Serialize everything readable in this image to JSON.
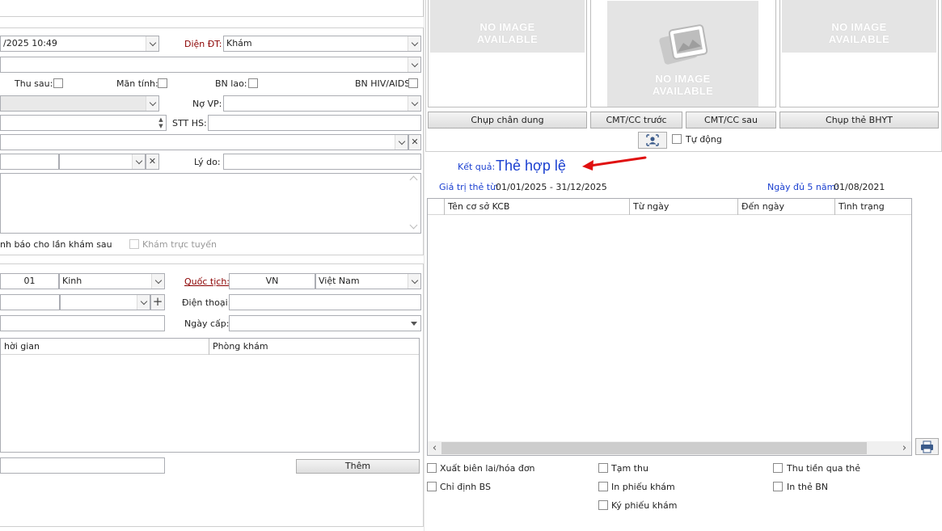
{
  "left": {
    "reg_time": "/2025 10:49",
    "dien_dt_label": "Diện ĐT:",
    "dien_dt_value": "Khám",
    "thu_sau_label": "Thu sau:",
    "man_tinh_label": "Mãn tính:",
    "bn_lao_label": "BN lao:",
    "bn_hiv_label": "BN HIV/AIDS",
    "no_vp_label": "Nợ VP:",
    "stt_hs_label": "STT HS:",
    "ly_do_label": "Lý do:",
    "notify_label": "nh báo cho lần khám sau",
    "online_label": "Khám trực tuyến",
    "age_value": "01",
    "ethnic_value": "Kinh",
    "quoc_tich_label": "Quốc tịch:",
    "quoc_tich_code": "VN",
    "quoc_tich_name": "Việt Nam",
    "dien_thoai_label": "Điện thoại:",
    "ngay_cap_label": "Ngày cấp:",
    "grid_col_time": "hời gian",
    "grid_col_room": "Phòng khám",
    "add_button": "Thêm"
  },
  "photos": {
    "no_image_line1": "NO IMAGE",
    "no_image_line2": "AVAILABLE",
    "btn_portrait": "Chụp chân dung",
    "btn_id_front": "CMT/CC trước",
    "btn_id_back": "CMT/CC sau",
    "btn_card": "Chụp thẻ BHYT",
    "auto_label": "Tự động"
  },
  "result": {
    "label": "Kết quả:",
    "value": "Thẻ hợp lệ",
    "validity_label": "Giá trị thẻ từ:",
    "validity_value": "01/01/2025 - 31/12/2025",
    "five_year_label": "Ngày đủ 5 năm:",
    "five_year_value": "01/08/2021",
    "arrow_color": "#e01010",
    "value_color": "#1a3fd0"
  },
  "history_grid": {
    "columns": [
      "Tên cơ sở KCB",
      "Từ ngày",
      "Đến ngày",
      "Tình trạng"
    ]
  },
  "options": {
    "xuat_bien_lai": "Xuất biên lai/hóa đơn",
    "tam_thu": "Tạm thu",
    "thu_tien_the": "Thu tiền qua thẻ",
    "chi_dinh_bs": "Chỉ định BS",
    "in_phieu_kham": "In phiếu khám",
    "in_the_bn": "In thẻ BN",
    "ky_phieu_kham": "Ký phiếu khám"
  }
}
